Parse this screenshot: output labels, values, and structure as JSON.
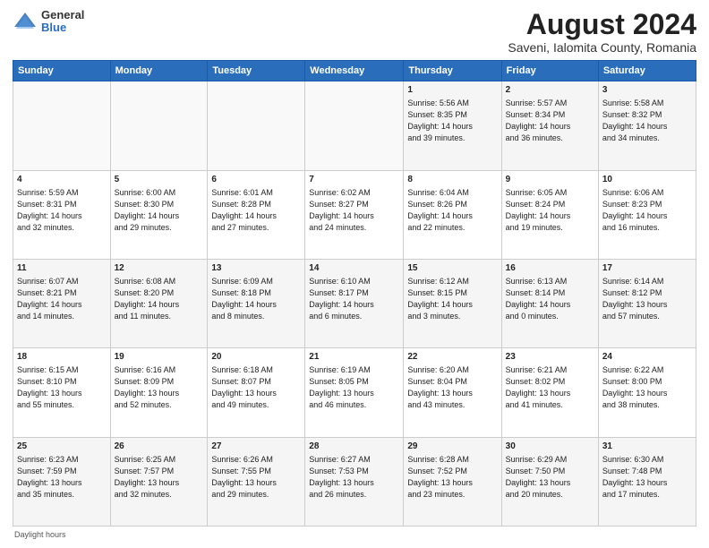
{
  "logo": {
    "general": "General",
    "blue": "Blue"
  },
  "title": {
    "month_year": "August 2024",
    "location": "Saveni, Ialomita County, Romania"
  },
  "headers": [
    "Sunday",
    "Monday",
    "Tuesday",
    "Wednesday",
    "Thursday",
    "Friday",
    "Saturday"
  ],
  "footer": "Daylight hours",
  "weeks": [
    [
      {
        "day": "",
        "info": ""
      },
      {
        "day": "",
        "info": ""
      },
      {
        "day": "",
        "info": ""
      },
      {
        "day": "",
        "info": ""
      },
      {
        "day": "1",
        "info": "Sunrise: 5:56 AM\nSunset: 8:35 PM\nDaylight: 14 hours\nand 39 minutes."
      },
      {
        "day": "2",
        "info": "Sunrise: 5:57 AM\nSunset: 8:34 PM\nDaylight: 14 hours\nand 36 minutes."
      },
      {
        "day": "3",
        "info": "Sunrise: 5:58 AM\nSunset: 8:32 PM\nDaylight: 14 hours\nand 34 minutes."
      }
    ],
    [
      {
        "day": "4",
        "info": "Sunrise: 5:59 AM\nSunset: 8:31 PM\nDaylight: 14 hours\nand 32 minutes."
      },
      {
        "day": "5",
        "info": "Sunrise: 6:00 AM\nSunset: 8:30 PM\nDaylight: 14 hours\nand 29 minutes."
      },
      {
        "day": "6",
        "info": "Sunrise: 6:01 AM\nSunset: 8:28 PM\nDaylight: 14 hours\nand 27 minutes."
      },
      {
        "day": "7",
        "info": "Sunrise: 6:02 AM\nSunset: 8:27 PM\nDaylight: 14 hours\nand 24 minutes."
      },
      {
        "day": "8",
        "info": "Sunrise: 6:04 AM\nSunset: 8:26 PM\nDaylight: 14 hours\nand 22 minutes."
      },
      {
        "day": "9",
        "info": "Sunrise: 6:05 AM\nSunset: 8:24 PM\nDaylight: 14 hours\nand 19 minutes."
      },
      {
        "day": "10",
        "info": "Sunrise: 6:06 AM\nSunset: 8:23 PM\nDaylight: 14 hours\nand 16 minutes."
      }
    ],
    [
      {
        "day": "11",
        "info": "Sunrise: 6:07 AM\nSunset: 8:21 PM\nDaylight: 14 hours\nand 14 minutes."
      },
      {
        "day": "12",
        "info": "Sunrise: 6:08 AM\nSunset: 8:20 PM\nDaylight: 14 hours\nand 11 minutes."
      },
      {
        "day": "13",
        "info": "Sunrise: 6:09 AM\nSunset: 8:18 PM\nDaylight: 14 hours\nand 8 minutes."
      },
      {
        "day": "14",
        "info": "Sunrise: 6:10 AM\nSunset: 8:17 PM\nDaylight: 14 hours\nand 6 minutes."
      },
      {
        "day": "15",
        "info": "Sunrise: 6:12 AM\nSunset: 8:15 PM\nDaylight: 14 hours\nand 3 minutes."
      },
      {
        "day": "16",
        "info": "Sunrise: 6:13 AM\nSunset: 8:14 PM\nDaylight: 14 hours\nand 0 minutes."
      },
      {
        "day": "17",
        "info": "Sunrise: 6:14 AM\nSunset: 8:12 PM\nDaylight: 13 hours\nand 57 minutes."
      }
    ],
    [
      {
        "day": "18",
        "info": "Sunrise: 6:15 AM\nSunset: 8:10 PM\nDaylight: 13 hours\nand 55 minutes."
      },
      {
        "day": "19",
        "info": "Sunrise: 6:16 AM\nSunset: 8:09 PM\nDaylight: 13 hours\nand 52 minutes."
      },
      {
        "day": "20",
        "info": "Sunrise: 6:18 AM\nSunset: 8:07 PM\nDaylight: 13 hours\nand 49 minutes."
      },
      {
        "day": "21",
        "info": "Sunrise: 6:19 AM\nSunset: 8:05 PM\nDaylight: 13 hours\nand 46 minutes."
      },
      {
        "day": "22",
        "info": "Sunrise: 6:20 AM\nSunset: 8:04 PM\nDaylight: 13 hours\nand 43 minutes."
      },
      {
        "day": "23",
        "info": "Sunrise: 6:21 AM\nSunset: 8:02 PM\nDaylight: 13 hours\nand 41 minutes."
      },
      {
        "day": "24",
        "info": "Sunrise: 6:22 AM\nSunset: 8:00 PM\nDaylight: 13 hours\nand 38 minutes."
      }
    ],
    [
      {
        "day": "25",
        "info": "Sunrise: 6:23 AM\nSunset: 7:59 PM\nDaylight: 13 hours\nand 35 minutes."
      },
      {
        "day": "26",
        "info": "Sunrise: 6:25 AM\nSunset: 7:57 PM\nDaylight: 13 hours\nand 32 minutes."
      },
      {
        "day": "27",
        "info": "Sunrise: 6:26 AM\nSunset: 7:55 PM\nDaylight: 13 hours\nand 29 minutes."
      },
      {
        "day": "28",
        "info": "Sunrise: 6:27 AM\nSunset: 7:53 PM\nDaylight: 13 hours\nand 26 minutes."
      },
      {
        "day": "29",
        "info": "Sunrise: 6:28 AM\nSunset: 7:52 PM\nDaylight: 13 hours\nand 23 minutes."
      },
      {
        "day": "30",
        "info": "Sunrise: 6:29 AM\nSunset: 7:50 PM\nDaylight: 13 hours\nand 20 minutes."
      },
      {
        "day": "31",
        "info": "Sunrise: 6:30 AM\nSunset: 7:48 PM\nDaylight: 13 hours\nand 17 minutes."
      }
    ]
  ]
}
